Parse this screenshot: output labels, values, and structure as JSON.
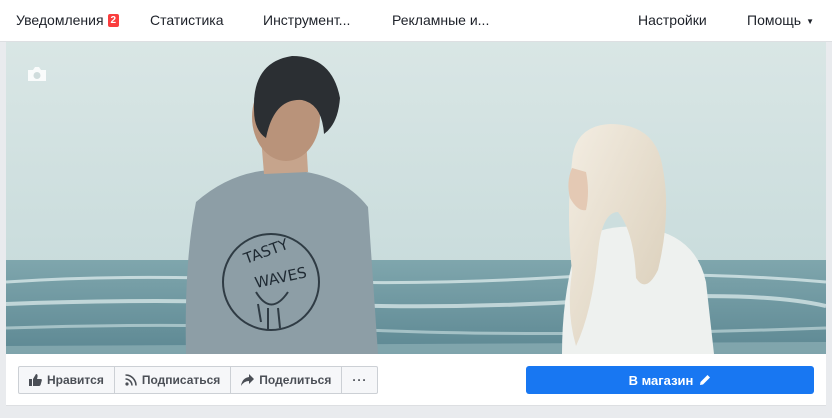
{
  "nav": {
    "notifications_label": "Уведомления",
    "notifications_count": "2",
    "statistics_label": "Статистика",
    "tools_label": "Инструмент...",
    "ads_label": "Рекламные и...",
    "settings_label": "Настройки",
    "help_label": "Помощь"
  },
  "cover": {
    "shirt_text_1": "TASTY",
    "shirt_text_2": "WAVES"
  },
  "actions": {
    "like_label": "Нравится",
    "follow_label": "Подписаться",
    "share_label": "Поделиться",
    "more_label": "···",
    "shop_label": "В магазин"
  },
  "colors": {
    "primary": "#1877f2",
    "badge": "#fa3e3e",
    "background": "#e9ebee"
  }
}
